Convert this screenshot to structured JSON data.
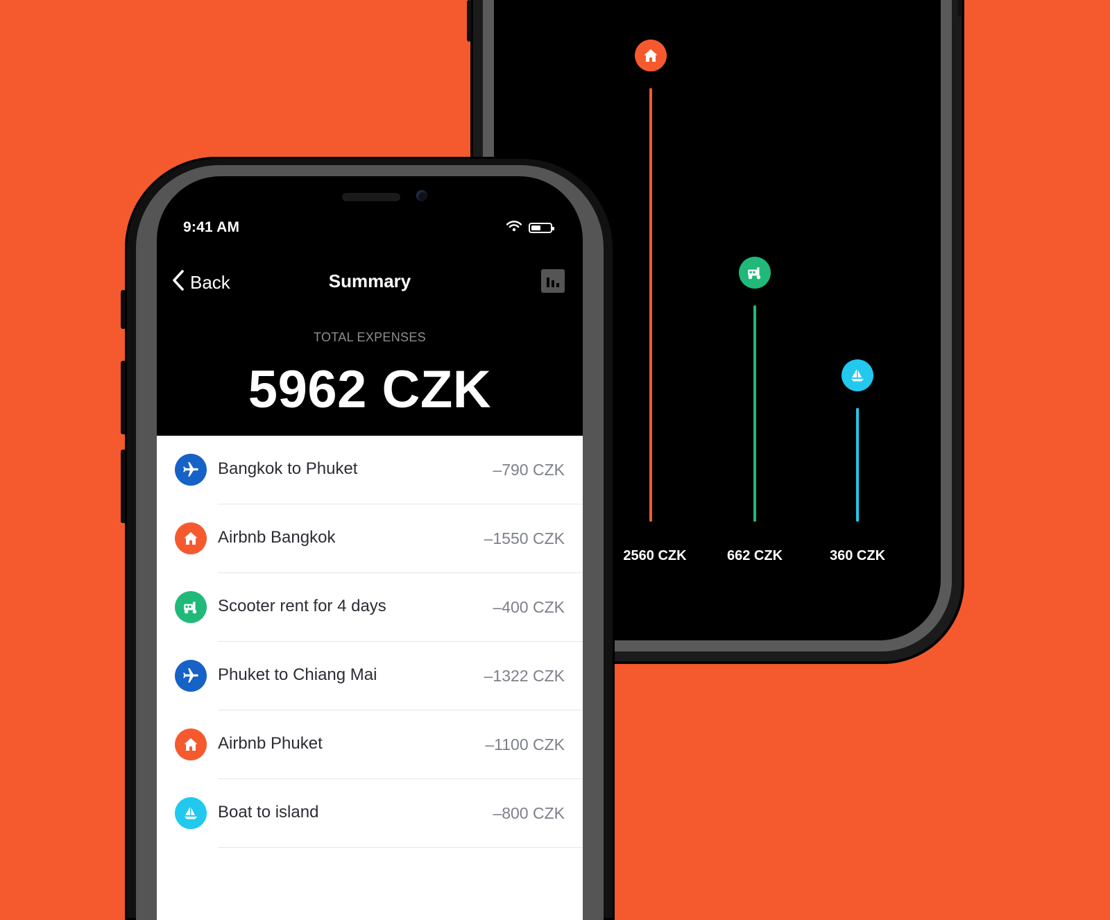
{
  "colors": {
    "background": "#F55A2F",
    "accommodation": "#F55A2F",
    "flight": "#1662C6",
    "scooter": "#20B97A",
    "boat": "#22C8EE"
  },
  "status_bar": {
    "time": "9:41 AM",
    "icons": [
      "wifi-icon",
      "battery-icon"
    ]
  },
  "nav": {
    "back_label": "Back",
    "title": "Summary",
    "chart_icon": "bar-chart-icon"
  },
  "total": {
    "label": "TOTAL EXPENSES",
    "value": "5962 CZK"
  },
  "expenses": [
    {
      "name": "Bangkok to Phuket",
      "amount": "–790 CZK",
      "category": "flight",
      "icon": "airplane-icon"
    },
    {
      "name": "Airbnb Bangkok",
      "amount": "–1550 CZK",
      "category": "accommodation",
      "icon": "house-icon"
    },
    {
      "name": "Scooter rent for 4 days",
      "amount": "–400 CZK",
      "category": "scooter",
      "icon": "scooter-icon"
    },
    {
      "name": "Phuket to Chiang Mai",
      "amount": "–1322 CZK",
      "category": "flight",
      "icon": "airplane-icon"
    },
    {
      "name": "Airbnb Phuket",
      "amount": "–1100 CZK",
      "category": "accommodation",
      "icon": "house-icon"
    },
    {
      "name": "Boat to island",
      "amount": "–800 CZK",
      "category": "boat",
      "icon": "sailboat-icon"
    }
  ],
  "category_chart": {
    "bars": [
      {
        "category": "accommodation",
        "label": "2560 CZK",
        "value": 2560,
        "icon": "house-icon"
      },
      {
        "category": "scooter",
        "label": "662 CZK",
        "value": 662,
        "icon": "scooter-icon"
      },
      {
        "category": "boat",
        "label": "360 CZK",
        "value": 360,
        "icon": "sailboat-icon"
      }
    ]
  }
}
